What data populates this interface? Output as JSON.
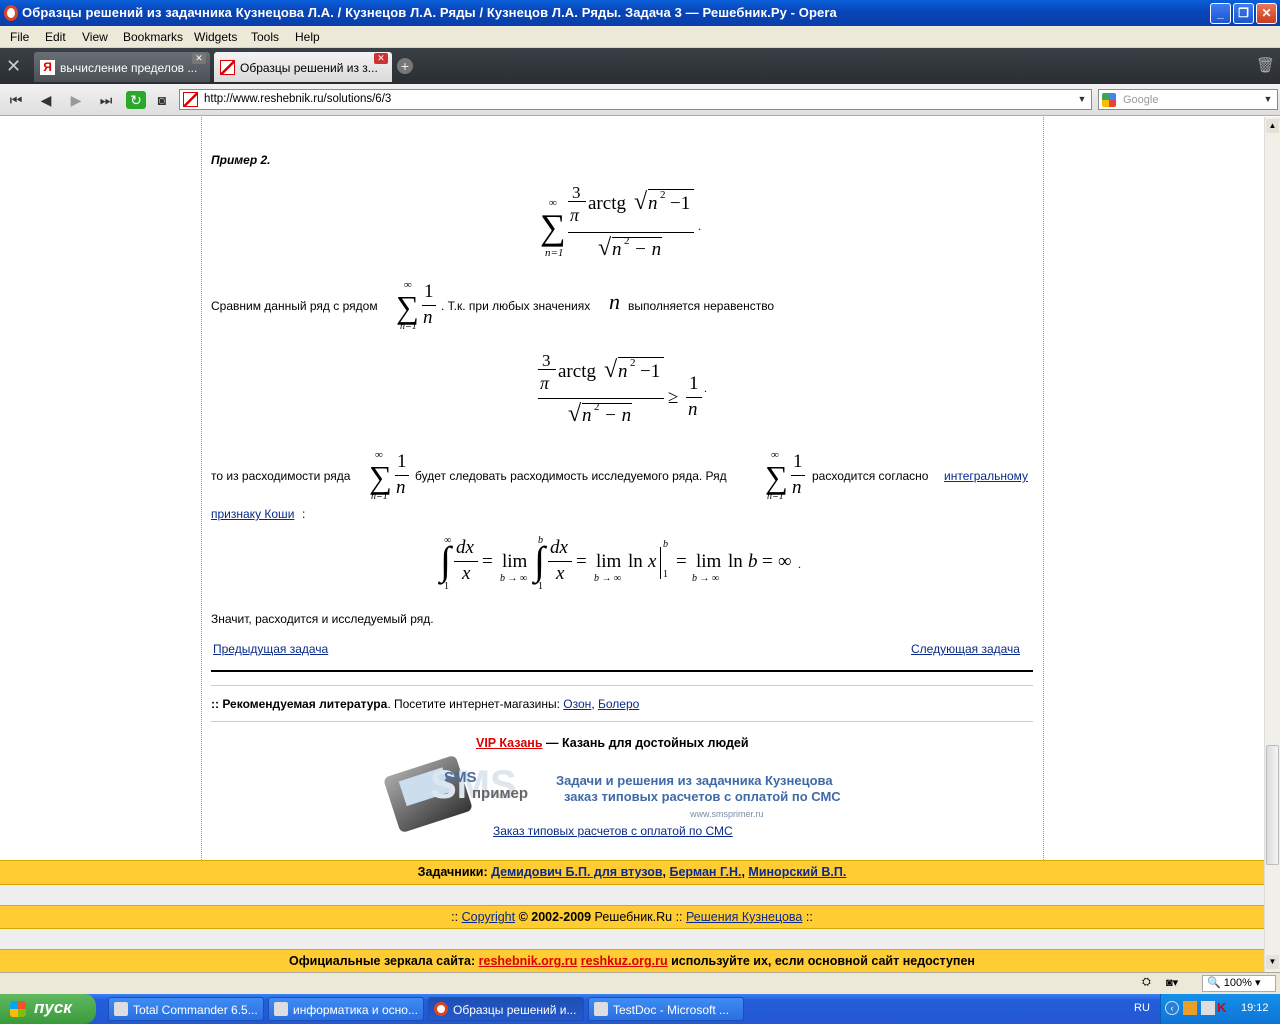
{
  "window": {
    "title": "Образцы решений из задачника Кузнецова Л.А. / Кузнецов Л.А. Ряды / Кузнецов Л.А. Ряды. Задача 3 — Решебник.Ру - Opera"
  },
  "menu": [
    "File",
    "Edit",
    "View",
    "Bookmarks",
    "Widgets",
    "Tools",
    "Help"
  ],
  "tabs": [
    {
      "label": "вычисление пределов ...",
      "icon": "yandex-icon",
      "active": false
    },
    {
      "label": "Образцы решений из з...",
      "icon": "reshebnik-icon",
      "active": true
    }
  ],
  "address": {
    "url": "http://www.reshebnik.ru/solutions/6/3",
    "search_placeholder": "Google"
  },
  "page": {
    "example_heading": "Пример 2.",
    "compare_text_a": "Сравним данный ряд с рядом",
    "compare_text_b": ". Т.к. при любых значениях",
    "compare_var": "n",
    "compare_text_c": "выполняется неравенство",
    "div_text_a": "то из расходимости ряда",
    "div_text_b": "будет следовать расходимость исследуемого ряда. Ряд",
    "div_text_c": "расходится согласно",
    "div_link_1": "интегральному",
    "div_link_2": "признаку Коши",
    "div_colon": ":",
    "conclusion": "Значит, расходится и исследуемый ряд.",
    "prev_link": "Предыдущая задача",
    "next_link": "Следующая задача",
    "lit_prefix": "::",
    "lit_bold": "Рекомендуемая литература",
    "lit_text": ". Посетите интернет-магазины:",
    "lit_links": [
      "Озон",
      "Болеро"
    ],
    "vip_link": "VIP Казань",
    "vip_text": "— Казань для достойных людей",
    "sms_logo_1": "SMS",
    "sms_logo_2": "пример",
    "sms_line1": "Задачи и решения из задачника Кузнецова",
    "sms_line2": "заказ типовых расчетов с оплатой по СМС",
    "sms_url": "www.smsprimer.ru",
    "sms_link": "Заказ типовых расчетов с оплатой по СМС"
  },
  "math": {
    "three": "3",
    "pi": "π",
    "arctg": "arctg",
    "n": "n",
    "one": "1",
    "two": "2",
    "minus1": "−1",
    "minus_n": "− n",
    "inf": "∞",
    "n_eq_1": "n=1",
    "dx": "dx",
    "x": "x",
    "lim": "lim",
    "b_to_inf": "b → ∞",
    "ln": "ln",
    "b": "b",
    "eq": "=",
    "geq": "≥",
    "dot": "."
  },
  "footer": {
    "bar1_label": "Задачники:",
    "bar1_links": [
      "Демидович Б.П. для втузов",
      "Берман Г.Н.",
      "Минорский В.П."
    ],
    "bar2_sep": "::",
    "bar2_copyright": "Copyright",
    "bar2_text": "© 2002-2009",
    "bar2_site": "Решебник.Ru ::",
    "bar2_link": "Решения Кузнецова",
    "bar2_end": "::",
    "bar3_label": "Официальные зеркала сайта:",
    "bar3_links": [
      "reshebnik.org.ru",
      "reshkuz.org.ru"
    ],
    "bar3_text": "используйте их, если основной сайт недоступен"
  },
  "status": {
    "zoom": "100%"
  },
  "taskbar": {
    "start": "пуск",
    "tasks": [
      "Total Commander 6.5...",
      "информатика и осно...",
      "Образцы решений и...",
      "TestDoc - Microsoft ..."
    ],
    "lang": "RU",
    "clock": "19:12"
  }
}
